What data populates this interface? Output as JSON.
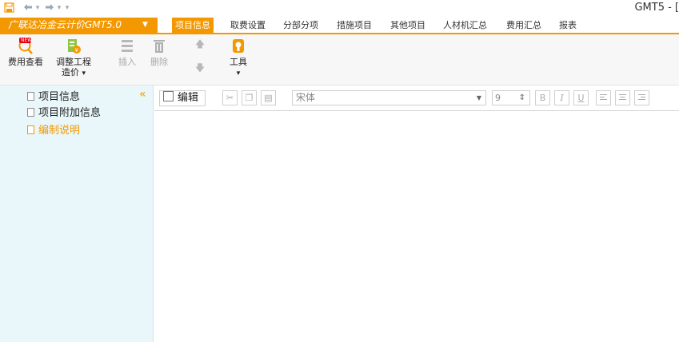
{
  "window": {
    "title": "GMT5 - ["
  },
  "quick_access": {
    "save_icon": "save-icon",
    "undo_icon": "undo-icon",
    "redo_icon": "redo-icon"
  },
  "brand": {
    "label": "广联达冶金云计价GMT5.0"
  },
  "tabs": [
    {
      "label": "项目信息",
      "active": true
    },
    {
      "label": "取费设置"
    },
    {
      "label": "分部分项"
    },
    {
      "label": "措施项目"
    },
    {
      "label": "其他项目"
    },
    {
      "label": "人材机汇总"
    },
    {
      "label": "费用汇总"
    },
    {
      "label": "报表"
    }
  ],
  "ribbon": {
    "fee_view": {
      "label": "费用查看",
      "badge": "NEW"
    },
    "adjust_price": {
      "line1": "调整工程",
      "line2": "造价"
    },
    "insert": {
      "label": "插入"
    },
    "delete": {
      "label": "删除"
    },
    "tools": {
      "label": "工具"
    }
  },
  "tree": {
    "items": [
      {
        "label": "项目信息"
      },
      {
        "label": "项目附加信息"
      },
      {
        "label": "编制说明",
        "selected": true
      }
    ]
  },
  "editor_toolbar": {
    "edit_label": "编辑",
    "font_name": "宋体",
    "font_size": "9",
    "bold": "B",
    "italic": "I",
    "underline": "U"
  },
  "colors": {
    "accent": "#f39800",
    "left_pane": "#e9f7fb"
  }
}
